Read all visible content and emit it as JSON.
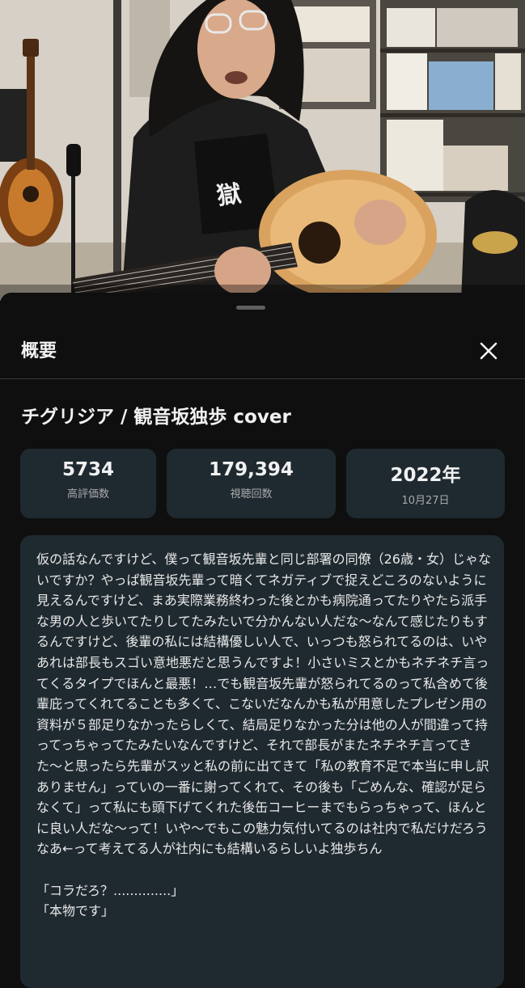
{
  "video": {
    "description": "guitarist-thumbnail"
  },
  "sheet": {
    "title": "概要",
    "close_icon": "close-icon"
  },
  "video_title": "チグリジア / 観音坂独歩 cover",
  "stats": [
    {
      "value": "5734",
      "label": "高評価数"
    },
    {
      "value": "179,394",
      "label": "視聴回数"
    },
    {
      "value": "2022年",
      "label": "10月27日"
    }
  ],
  "description_text": "仮の話なんですけど、僕って観音坂先輩と同じ部署の同僚（26歳・女）じゃないですか？やっぱ観音坂先輩って暗くてネガティブで捉えどころのないように見えるんですけど、まあ実際業務終わった後とかも病院通ってたりやたら派手な男の人と歩いてたりしてたみたいで分かんない人だな〜なんて感じたりもするんですけど、後輩の私には結構優しい人で、いっつも怒られてるのは、いやあれは部長もスゴい意地悪だと思うんですよ！小さいミスとかもネチネチ言ってくるタイプでほんと最悪！…でも観音坂先輩が怒られてるのって私含めて後輩庇ってくれてることも多くて、こないだなんかも私が用意したプレゼン用の資料が５部足りなかったらしくて、結局足りなかった分は他の人が間違って持ってっちゃってたみたいなんですけど、それで部長がまたネチネチ言ってきた〜と思ったら先輩がスッと私の前に出てきて「私の教育不足で本当に申し訳ありません」っていの一番に謝ってくれて、その後も「ごめんな、確認が足らなくて」って私にも頭下げてくれた後缶コーヒーまでもらっちゃって、ほんとに良い人だな〜って！いや〜でもこの魅力気付いてるのは社内で私だけだろうなあ←って考えてる人が社内にも結構いるらしいよ独歩ちん\n\n「コラだろ？..............」\n「本物です」"
}
